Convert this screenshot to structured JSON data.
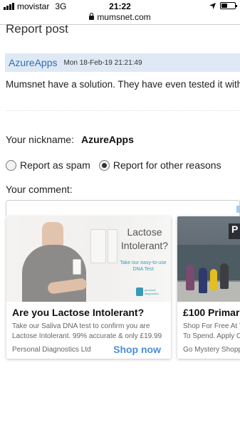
{
  "status_bar": {
    "carrier": "movistar",
    "network": "3G",
    "time": "21:22",
    "battery_level": 0.45
  },
  "browser": {
    "domain": "mumsnet.com"
  },
  "page": {
    "title": "Report post"
  },
  "post": {
    "author": "AzureApps",
    "date": "Mon 18-Feb-19 21:21:49",
    "body": "Mumsnet have a solution. They have even tested it with"
  },
  "form": {
    "nickname_label": "Your nickname:",
    "nickname_value": "AzureApps",
    "report_spam_label": "Report as spam",
    "report_other_label": "Report for other reasons",
    "selected_option": "Report for other reasons",
    "comment_label": "Your comment:",
    "comment_value": ""
  },
  "ads": [
    {
      "image_headline": "Lactose Intolerant?",
      "image_subline": "Take our easy-to-use DNA Test",
      "image_logo_text": "personal diagnostics",
      "title": "Are you Lactose Intolerant?",
      "description_line1": "Take our Saliva DNA test to confirm you are",
      "description_line2": "Lactose Intolerant. 99% accurate & only £19.99",
      "source": "Personal Diagnostics Ltd",
      "cta": "Shop now"
    },
    {
      "image_sign": "P",
      "title": "£100 Primar",
      "description_line1": "Shop For Free At Y",
      "description_line2": "To Spend. Apply O",
      "source": "Go Mystery Shopp"
    }
  ],
  "colors": {
    "author_link": "#2f6fb4",
    "post_header_bg": "#dfe9f5",
    "cta": "#4a8ed8"
  }
}
